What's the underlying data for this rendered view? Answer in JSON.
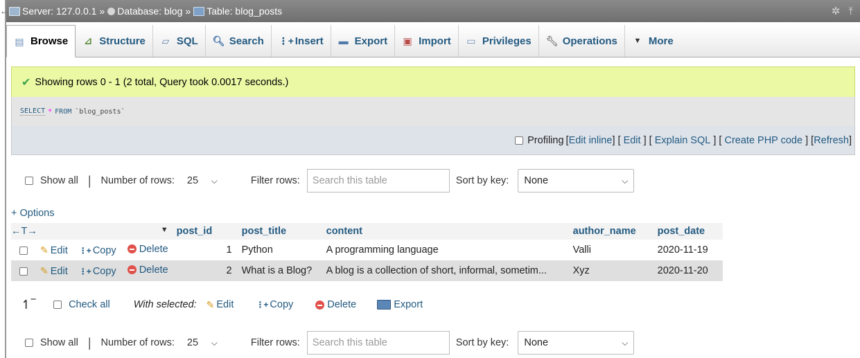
{
  "breadcrumb": {
    "server": "Server: 127.0.0.1",
    "database": "Database: blog",
    "table": "Table: blog_posts",
    "separator": "»"
  },
  "tabs": [
    {
      "label": "Browse",
      "icon": "browse-icon",
      "active": true
    },
    {
      "label": "Structure",
      "icon": "structure-icon",
      "active": false
    },
    {
      "label": "SQL",
      "icon": "sql-icon",
      "active": false
    },
    {
      "label": "Search",
      "icon": "search-icon",
      "active": false
    },
    {
      "label": "Insert",
      "icon": "insert-icon",
      "active": false
    },
    {
      "label": "Export",
      "icon": "export-icon",
      "active": false
    },
    {
      "label": "Import",
      "icon": "import-icon",
      "active": false
    },
    {
      "label": "Privileges",
      "icon": "privileges-icon",
      "active": false
    },
    {
      "label": "Operations",
      "icon": "wrench-icon",
      "active": false
    },
    {
      "label": "More",
      "icon": "caret-down-icon",
      "active": false
    }
  ],
  "message": {
    "success": "Showing rows 0 - 1 (2 total, Query took 0.0017 seconds.)"
  },
  "sql": {
    "select": "SELECT",
    "star": "*",
    "from": "FROM",
    "table": "`blog_posts`"
  },
  "tools": {
    "profiling": "Profiling",
    "edit_inline": "Edit inline",
    "edit": "Edit",
    "explain": "Explain SQL",
    "php": "Create PHP code",
    "refresh": "Refresh"
  },
  "nav": {
    "show_all": "Show all",
    "rows_label": "Number of rows:",
    "rows_value": "25",
    "filter_label": "Filter rows:",
    "filter_placeholder": "Search this table",
    "sort_label": "Sort by key:",
    "sort_value": "None"
  },
  "options": "+ Options",
  "table": {
    "arrows": "←T→",
    "columns": [
      "post_id",
      "post_title",
      "content",
      "author_name",
      "post_date"
    ],
    "actions": {
      "edit": "Edit",
      "copy": "Copy",
      "delete": "Delete"
    },
    "rows": [
      {
        "post_id": "1",
        "post_title": "Python",
        "content": "A programming language",
        "author_name": "Valli",
        "post_date": "2020-11-19"
      },
      {
        "post_id": "2",
        "post_title": "What is a Blog?",
        "content": "A blog is a collection of short, informal, sometim...",
        "author_name": "Xyz",
        "post_date": "2020-11-20"
      }
    ]
  },
  "bulk": {
    "check_all": "Check all",
    "with_selected": "With selected:",
    "edit": "Edit",
    "copy": "Copy",
    "delete": "Delete",
    "export": "Export"
  },
  "colors": {
    "link": "#235a81",
    "success_bg": "#ebf8a4",
    "topbar": "#7a7a7a"
  }
}
